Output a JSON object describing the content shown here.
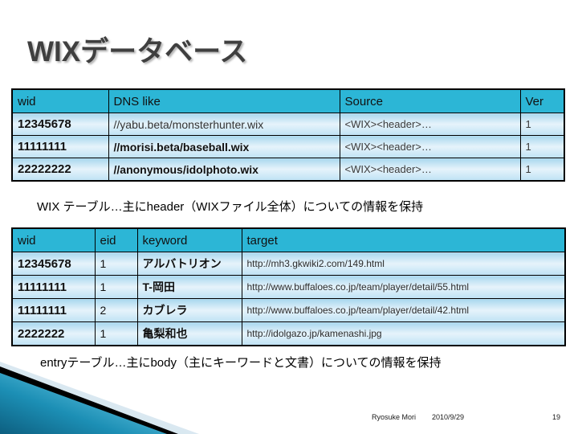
{
  "slide": {
    "title": "WIXデータベース",
    "page_number": "19",
    "author": "Ryosuke Mori",
    "date": "2010/9/29",
    "accent_color": "#2cb6d6",
    "row_color": "#cfe6f5",
    "title_color": "#3f3f3f"
  },
  "wix_table": {
    "name": "WIX テーブル",
    "headers": [
      "wid",
      "DNS like",
      "Source",
      "Ver"
    ],
    "rows": [
      {
        "wid": "12345678",
        "dns_like": "//yabu.beta/monsterhunter.wix",
        "source": "<WIX><header>…",
        "ver": "1"
      },
      {
        "wid": "11111111",
        "dns_like": "//morisi.beta/baseball.wix",
        "source": "<WIX><header>…",
        "ver": "1"
      },
      {
        "wid": "22222222",
        "dns_like": "//anonymous/idolphoto.wix",
        "source": "<WIX><header>…",
        "ver": "1"
      }
    ],
    "caption": "WIX テーブル…主にheader（WIXファイル全体）についての情報を保持"
  },
  "entry_table": {
    "name": "entryテーブル",
    "headers": [
      "wid",
      "eid",
      "keyword",
      "target"
    ],
    "rows": [
      {
        "wid": "12345678",
        "eid": "1",
        "keyword": "アルバトリオン",
        "target": "http://mh3.gkwiki2.com/149.html"
      },
      {
        "wid": "11111111",
        "eid": "1",
        "keyword": "T-岡田",
        "target": "http://www.buffaloes.co.jp/team/player/detail/55.html"
      },
      {
        "wid": "11111111",
        "eid": "2",
        "keyword": "カブレラ",
        "target": "http://www.buffaloes.co.jp/team/player/detail/42.html"
      },
      {
        "wid": "2222222",
        "eid": "1",
        "keyword": "亀梨和也",
        "target": "http://idolgazo.jp/kamenashi.jpg"
      }
    ],
    "caption": "entryテーブル…主にbody（主にキーワードと文書）についての情報を保持"
  }
}
